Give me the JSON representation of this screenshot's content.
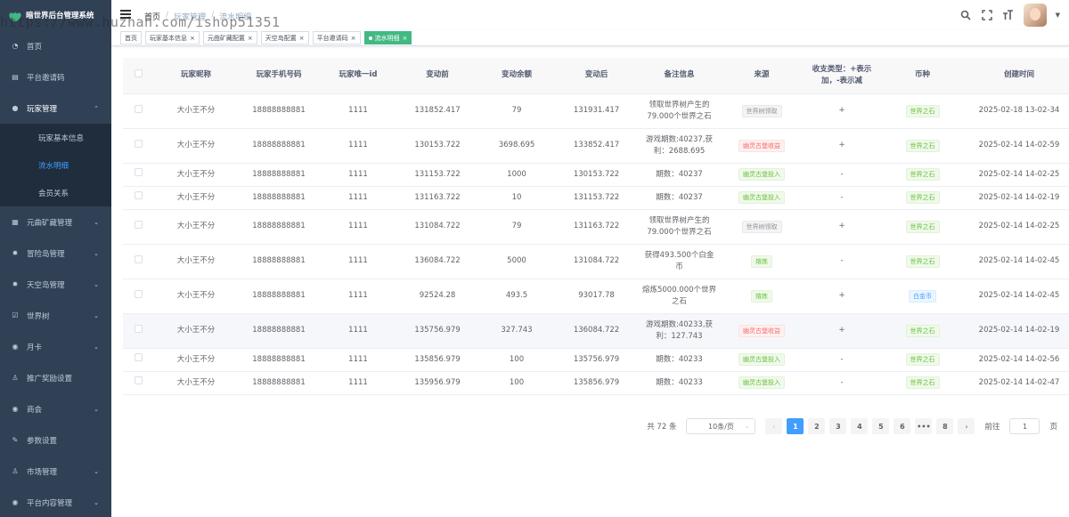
{
  "app": {
    "title": "暗世界后台管理系统"
  },
  "sidebar": {
    "items": [
      {
        "label": "首页",
        "icon": "dashboard-icon"
      },
      {
        "label": "平台邀请码",
        "icon": "document-icon"
      },
      {
        "label": "玩家管理",
        "icon": "user-icon",
        "open": true,
        "children": [
          {
            "label": "玩家基本信息"
          },
          {
            "label": "流水明细",
            "active": true
          },
          {
            "label": "会员关系"
          }
        ]
      },
      {
        "label": "元曲矿藏管理",
        "icon": "grid-icon",
        "expandable": true
      },
      {
        "label": "冒险岛管理",
        "icon": "bug-icon",
        "expandable": true
      },
      {
        "label": "天空岛管理",
        "icon": "bug-icon",
        "expandable": true
      },
      {
        "label": "世界树",
        "icon": "checkbox-icon",
        "expandable": true
      },
      {
        "label": "月卡",
        "icon": "money-icon",
        "expandable": true
      },
      {
        "label": "推广奖励设置",
        "icon": "person-icon",
        "expandable": false
      },
      {
        "label": "商会",
        "icon": "money-icon",
        "expandable": true
      },
      {
        "label": "参数设置",
        "icon": "edit-icon",
        "expandable": false
      },
      {
        "label": "市场管理",
        "icon": "person-icon",
        "expandable": true
      },
      {
        "label": "平台内容管理",
        "icon": "money-icon",
        "expandable": true
      }
    ]
  },
  "header": {
    "breadcrumb": [
      "首页",
      "玩家管理",
      "流水明细"
    ]
  },
  "tags": [
    {
      "label": "首页",
      "closable": false
    },
    {
      "label": "玩家基本信息",
      "closable": true
    },
    {
      "label": "元曲矿藏配置",
      "closable": true
    },
    {
      "label": "天空岛配置",
      "closable": true
    },
    {
      "label": "平台邀请码",
      "closable": true
    },
    {
      "label": "流水明细",
      "closable": true,
      "active": true
    }
  ],
  "table": {
    "columns": [
      "玩家昵称",
      "玩家手机号码",
      "玩家唯一id",
      "变动前",
      "变动余额",
      "变动后",
      "备注信息",
      "来源",
      "收支类型：+表示加，-表示减",
      "币种",
      "创建时间"
    ],
    "rows": [
      {
        "nickname": "大小王不分",
        "phone": "18888888881",
        "uid": "1111",
        "before": "131852.417",
        "change": "79",
        "after": "131931.417",
        "remark": "领取世界树产生的79.000个世界之石",
        "source": "世界树领取",
        "source_style": "info",
        "type": "+",
        "currency": "世界之石",
        "currency_style": "success",
        "created": "2025-02-18 13-02-34",
        "tall": true
      },
      {
        "nickname": "大小王不分",
        "phone": "18888888881",
        "uid": "1111",
        "before": "130153.722",
        "change": "3698.695",
        "after": "133852.417",
        "remark": "游戏期数:40237,获利：2688.695",
        "source": "幽灵古堡收益",
        "source_style": "danger",
        "type": "+",
        "currency": "世界之石",
        "currency_style": "success",
        "created": "2025-02-14 14-02-59",
        "tall": true
      },
      {
        "nickname": "大小王不分",
        "phone": "18888888881",
        "uid": "1111",
        "before": "131153.722",
        "change": "1000",
        "after": "130153.722",
        "remark": "期数：40237",
        "source": "幽灵古堡投入",
        "source_style": "success",
        "type": "-",
        "currency": "世界之石",
        "currency_style": "success",
        "created": "2025-02-14 14-02-25",
        "tall": false
      },
      {
        "nickname": "大小王不分",
        "phone": "18888888881",
        "uid": "1111",
        "before": "131163.722",
        "change": "10",
        "after": "131153.722",
        "remark": "期数：40237",
        "source": "幽灵古堡投入",
        "source_style": "success",
        "type": "-",
        "currency": "世界之石",
        "currency_style": "success",
        "created": "2025-02-14 14-02-19",
        "tall": false
      },
      {
        "nickname": "大小王不分",
        "phone": "18888888881",
        "uid": "1111",
        "before": "131084.722",
        "change": "79",
        "after": "131163.722",
        "remark": "领取世界树产生的79.000个世界之石",
        "source": "世界树领取",
        "source_style": "info",
        "type": "+",
        "currency": "世界之石",
        "currency_style": "success",
        "created": "2025-02-14 14-02-25",
        "tall": true
      },
      {
        "nickname": "大小王不分",
        "phone": "18888888881",
        "uid": "1111",
        "before": "136084.722",
        "change": "5000",
        "after": "131084.722",
        "remark": "获得493.500个白金币",
        "source": "熔炼",
        "source_style": "success",
        "type": "-",
        "currency": "世界之石",
        "currency_style": "success",
        "created": "2025-02-14 14-02-45",
        "tall": true
      },
      {
        "nickname": "大小王不分",
        "phone": "18888888881",
        "uid": "1111",
        "before": "92524.28",
        "change": "493.5",
        "after": "93017.78",
        "remark": "熔炼5000.000个世界之石",
        "source": "熔炼",
        "source_style": "success",
        "type": "+",
        "currency": "白金币",
        "currency_style": "primary",
        "created": "2025-02-14 14-02-45",
        "tall": true
      },
      {
        "nickname": "大小王不分",
        "phone": "18888888881",
        "uid": "1111",
        "before": "135756.979",
        "change": "327.743",
        "after": "136084.722",
        "remark": "游戏期数:40233,获利：127.743",
        "source": "幽灵古堡收益",
        "source_style": "danger",
        "type": "+",
        "currency": "世界之石",
        "currency_style": "success",
        "created": "2025-02-14 14-02-19",
        "tall": true,
        "highlight": true
      },
      {
        "nickname": "大小王不分",
        "phone": "18888888881",
        "uid": "1111",
        "before": "135856.979",
        "change": "100",
        "after": "135756.979",
        "remark": "期数：40233",
        "source": "幽灵古堡投入",
        "source_style": "success",
        "type": "-",
        "currency": "世界之石",
        "currency_style": "success",
        "created": "2025-02-14 14-02-56",
        "tall": false
      },
      {
        "nickname": "大小王不分",
        "phone": "18888888881",
        "uid": "1111",
        "before": "135956.979",
        "change": "100",
        "after": "135856.979",
        "remark": "期数：40233",
        "source": "幽灵古堡投入",
        "source_style": "success",
        "type": "-",
        "currency": "世界之石",
        "currency_style": "success",
        "created": "2025-02-14 14-02-47",
        "tall": false
      }
    ]
  },
  "pagination": {
    "total_label": "共 72 条",
    "page_size": "10条/页",
    "pages": [
      "1",
      "2",
      "3",
      "4",
      "5",
      "6",
      "•••",
      "8"
    ],
    "current": "1",
    "goto_label": "前往",
    "goto_value": "1",
    "page_unit": "页"
  },
  "watermark": "https://www.huzhan.com/ishop51351",
  "colors": {
    "sidebar_bg": "#304156",
    "accent": "#409eff",
    "tag_active": "#42b983"
  }
}
